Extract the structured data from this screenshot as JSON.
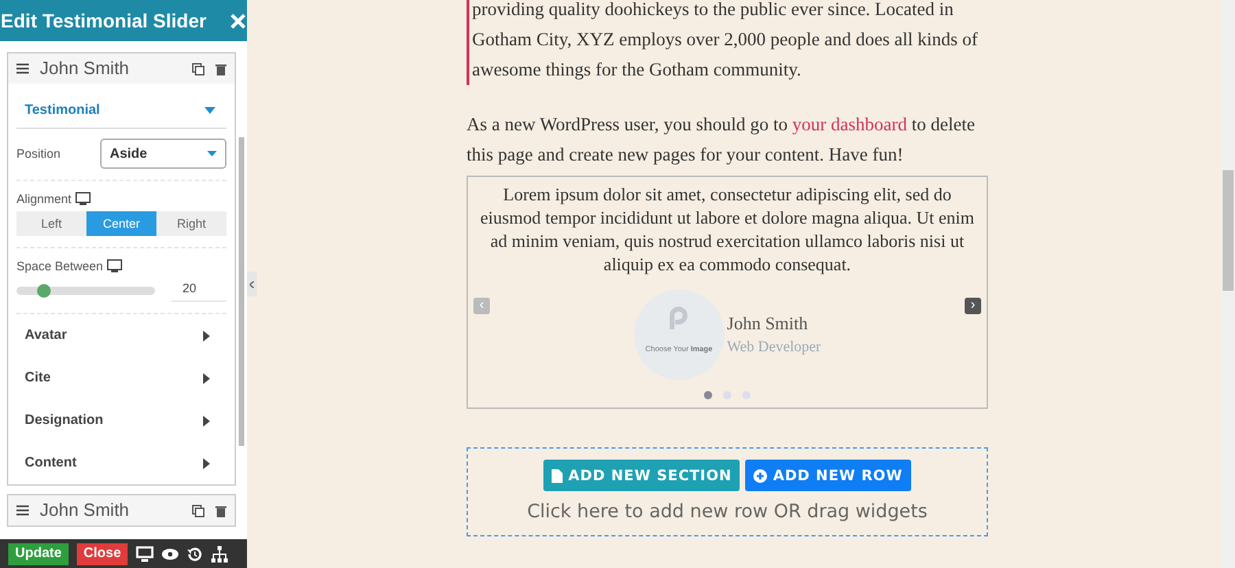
{
  "editor": {
    "title": "Edit Testimonial Slider",
    "items": [
      {
        "name": "John Smith",
        "expanded": true
      },
      {
        "name": "John Smith",
        "expanded": false
      }
    ],
    "section": {
      "title": "Testimonial",
      "expanded": true
    },
    "position": {
      "label": "Position",
      "value": "Aside"
    },
    "alignment": {
      "label": "Alignment",
      "options": [
        {
          "label": "Left",
          "selected": false
        },
        {
          "label": "Center",
          "selected": true
        },
        {
          "label": "Right",
          "selected": false
        }
      ]
    },
    "space_between": {
      "label": "Space Between",
      "level": 0.2,
      "value": "20"
    },
    "groups": [
      {
        "title": "Avatar",
        "expanded": false
      },
      {
        "title": "Cite",
        "expanded": false
      },
      {
        "title": "Designation",
        "expanded": false
      },
      {
        "title": "Content",
        "expanded": false
      }
    ],
    "footer": {
      "update": "Update",
      "close": "Close"
    }
  },
  "page": {
    "paragraph": "providing quality doohickeys to the public ever since. Located in Gotham City, XYZ employs over 2,000 people and does all kinds of awesome things for the Gotham community.",
    "notice": {
      "before": "As a new WordPress user, you should go to",
      "link": "your dashboard",
      "after": "to delete this page and create new pages for your content. Have fun!"
    },
    "testimonial": {
      "quote": "Lorem ipsum dolor sit amet, consectetur adipiscing elit, sed do eiusmod tempor incididunt ut labore et dolore magna aliqua. Ut enim ad minim veniam, quis nostrud exercitation ullamco laboris nisi ut aliquip ex ea commodo consequat.",
      "prev": "‹",
      "next": "›",
      "avatar_caption": "Choose Your **Image**",
      "name": "John Smith",
      "role": "Web Developer",
      "dots": [
        {
          "selected": true
        },
        {
          "selected": false
        },
        {
          "selected": false
        }
      ]
    },
    "builder": {
      "add_section": "ADD NEW SECTION",
      "add_row": "ADD NEW ROW",
      "hint": "Click here to add new row OR drag widgets"
    }
  }
}
